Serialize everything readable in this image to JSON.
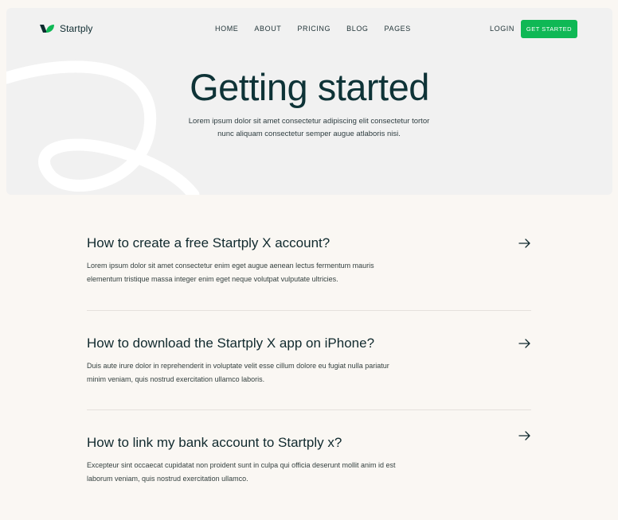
{
  "brand": {
    "name": "Startply",
    "primary_color": "#0fb855",
    "dark_color": "#0e2b30"
  },
  "nav": {
    "items": [
      {
        "label": "HOME"
      },
      {
        "label": "ABOUT"
      },
      {
        "label": "PRICING"
      },
      {
        "label": "BLOG"
      },
      {
        "label": "PAGES"
      }
    ],
    "login_label": "LOGIN",
    "cta_label": "GET STARTED"
  },
  "hero": {
    "title": "Getting started",
    "subtitle": "Lorem ipsum dolor sit amet consectetur adipiscing elit consectetur tortor nunc aliquam consectetur semper augue atlaboris nisi."
  },
  "faq": [
    {
      "question": "How to create a free Startply X account?",
      "answer": "Lorem ipsum dolor sit amet consectetur enim eget augue aenean lectus fermentum mauris elementum tristique massa integer enim eget neque volutpat vulputate ultricies.",
      "icon": "arrow-right-icon"
    },
    {
      "question": "How to download the Startply X app on iPhone?",
      "answer": "Duis aute irure dolor in reprehenderit in voluptate velit esse cillum dolore eu fugiat nulla pariatur minim veniam, quis nostrud exercitation ullamco laboris.",
      "icon": "arrow-right-icon"
    },
    {
      "question": "How to link my bank account to Startply x?",
      "answer": "Excepteur sint occaecat cupidatat non proident sunt in culpa qui officia deserunt mollit anim id est laborum veniam, quis nostrud exercitation ullamco.",
      "icon": "arrow-right-icon"
    }
  ]
}
